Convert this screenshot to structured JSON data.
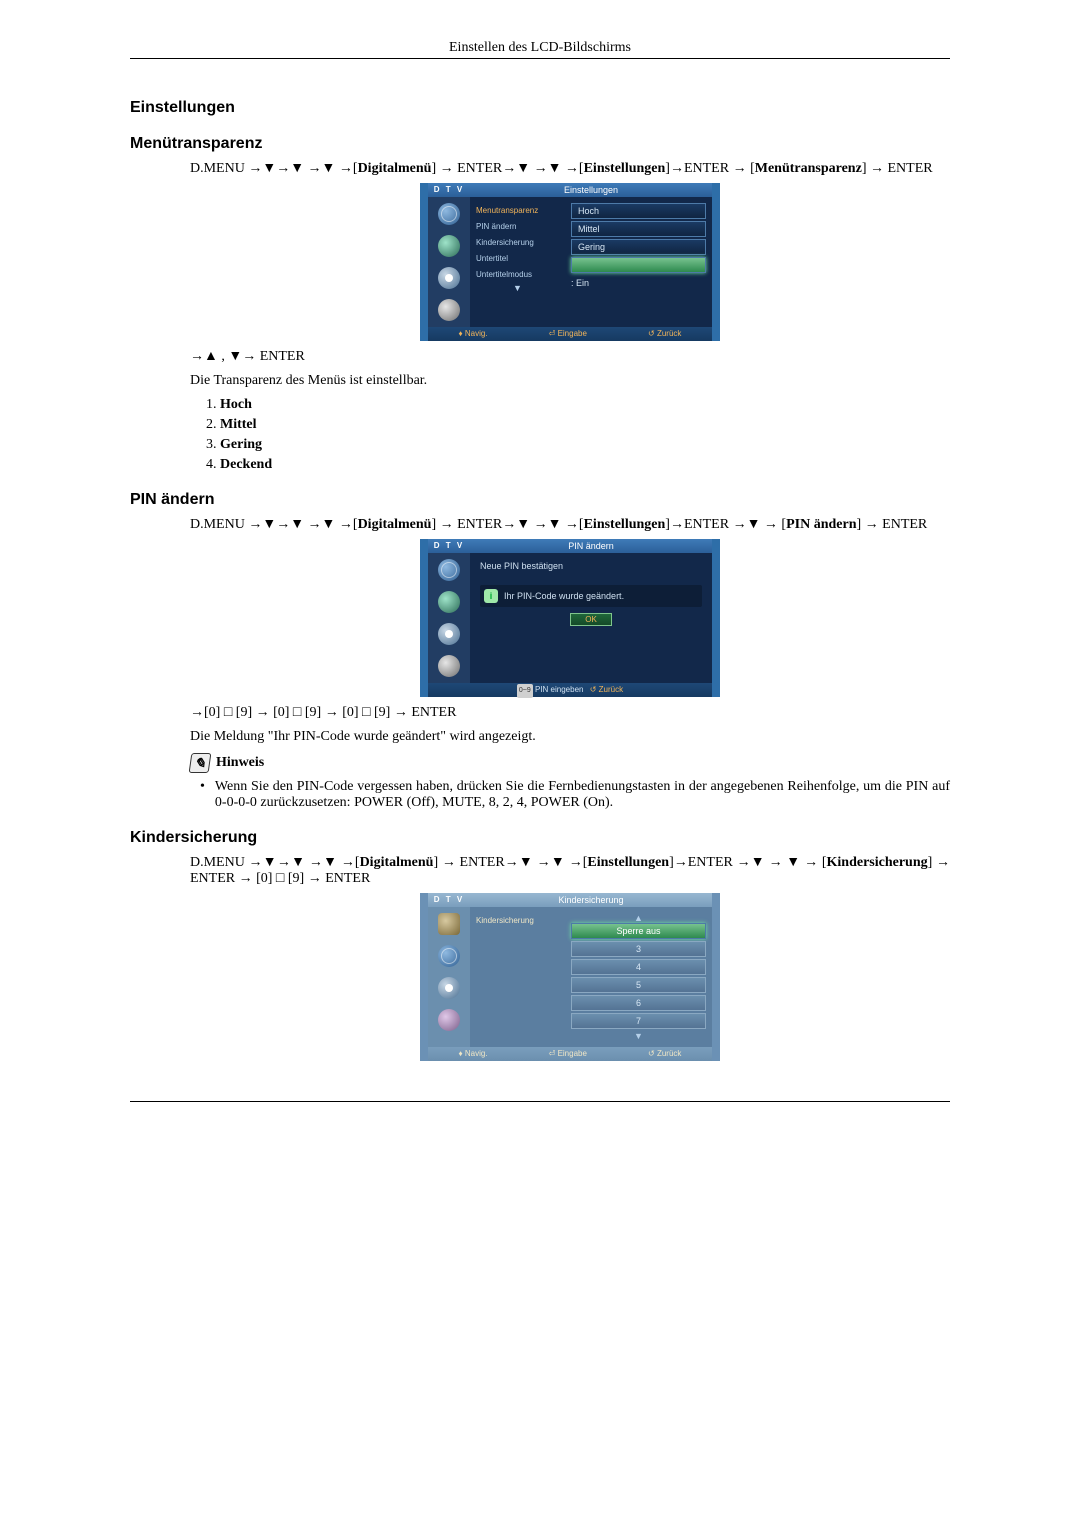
{
  "header": {
    "title": "Einstellen des LCD-Bildschirms"
  },
  "section_einstellungen": {
    "heading": "Einstellungen"
  },
  "section_menutrans": {
    "heading": "Menütransparenz",
    "path": "D.MENU →▼→▼ →▼ →[Digitalmenü] → ENTER→▼ →▼ →[Einstellungen]→ENTER → [Menütransparenz] → ENTER",
    "post_path": "→▲ , ▼→ ENTER",
    "desc": "Die Transparenz des Menüs ist einstellbar.",
    "items": [
      "Hoch",
      "Mittel",
      "Gering",
      "Deckend"
    ],
    "n1": "1.",
    "n2": "2.",
    "n3": "3.",
    "n4": "4."
  },
  "osd1": {
    "dtv": "D T V",
    "title": "Einstellungen",
    "left_items": [
      "Menutransparenz",
      "PIN ändern",
      "Kindersicherung",
      "Untertitel",
      "Untertitelmodus"
    ],
    "right_opts": [
      "Hoch",
      "Mittel",
      "Gering"
    ],
    "untertitel_val": ": Ein",
    "footer": {
      "nav": "♦ Navig.",
      "enter": "⏎ Eingabe",
      "back": "↺ Zurück"
    }
  },
  "section_pin": {
    "heading": "PIN ändern",
    "path": "D.MENU →▼→▼ →▼ →[Digitalmenü] → ENTER→▼ →▼ →[Einstellungen]→ENTER →▼ → [PIN ändern] → ENTER",
    "post_path": "→[0] □ [9] → [0] □ [9] → [0] □ [9] → ENTER",
    "desc": "Die Meldung \"Ihr PIN-Code wurde geändert\" wird angezeigt.",
    "hinweis_label": "Hinweis",
    "hinweis_text": "Wenn Sie den PIN-Code vergessen haben, drücken Sie die Fernbedienungstasten in der angegebenen Reihenfolge, um die PIN auf 0-0-0-0 zurückzusetzen: POWER (Off), MUTE, 8, 2, 4, POWER (On)."
  },
  "osd2": {
    "dtv": "D T V",
    "title": "PIN ändern",
    "confirm": "Neue PIN bestätigen",
    "msg": "Ihr PIN-Code wurde geändert.",
    "ok": "OK",
    "foot_digits": "0~9",
    "foot_enter": "PIN eingeben",
    "foot_back": "↺  Zurück"
  },
  "section_kinder": {
    "heading": "Kindersicherung",
    "path": "D.MENU →▼→▼ →▼ →[Digitalmenü] → ENTER→▼ →▼ →[Einstellungen]→ENTER →▼ → ▼ → [Kindersicherung] → ENTER → [0] □ [9] → ENTER"
  },
  "osd3": {
    "dtv": "D T V",
    "title": "Kindersicherung",
    "left_label": "Kindersicherung",
    "opts": [
      "Sperre aus",
      "3",
      "4",
      "5",
      "6",
      "7"
    ],
    "footer": {
      "nav": "♦ Navig.",
      "enter": "⏎ Eingabe",
      "back": "↺ Zurück"
    }
  }
}
